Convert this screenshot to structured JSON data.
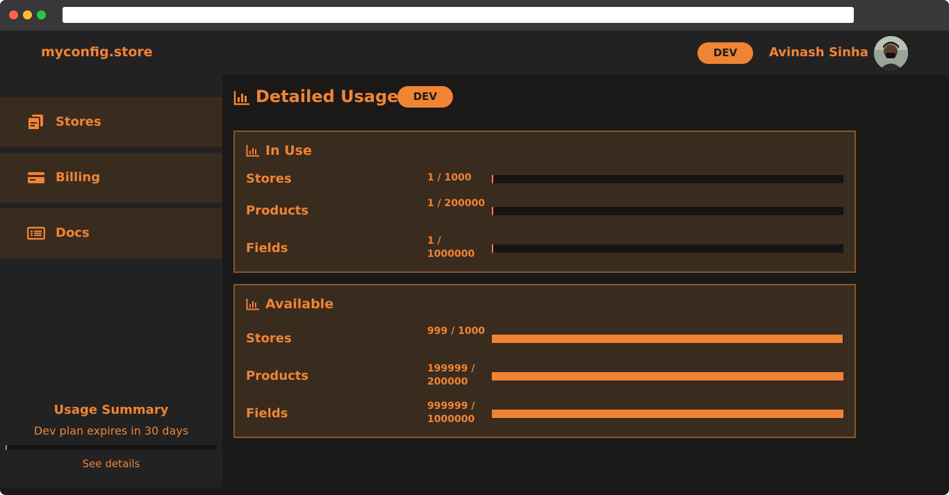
{
  "browser": {
    "url": ""
  },
  "header": {
    "brand": "myconfig.store",
    "env_badge": "DEV",
    "username": "Avinash Sinha",
    "avatar_icon": "user-avatar"
  },
  "sidebar": {
    "items": [
      {
        "label": "Stores",
        "icon": "stores-icon"
      },
      {
        "label": "Billing",
        "icon": "credit-card-icon"
      },
      {
        "label": "Docs",
        "icon": "docs-icon"
      }
    ],
    "usage_summary": {
      "title": "Usage Summary",
      "subtitle": "Dev plan expires in 30 days",
      "progress": 0.003,
      "link": "See details"
    }
  },
  "main": {
    "title": "Detailed Usage",
    "env_badge": "DEV",
    "in_use": {
      "title": "In Use",
      "rows": [
        {
          "label": "Stores",
          "value": "1 / 1000",
          "fraction": 0.001
        },
        {
          "label": "Products",
          "value": "1 / 200000",
          "fraction": 5e-06
        },
        {
          "label": "Fields",
          "value": "1 / 1000000",
          "fraction": 1e-06
        }
      ]
    },
    "available": {
      "title": "Available",
      "rows": [
        {
          "label": "Stores",
          "value": "999 / 1000",
          "fraction": 0.999
        },
        {
          "label": "Products",
          "value": "199999 / 200000",
          "fraction": 0.999995
        },
        {
          "label": "Fields",
          "value": "999999 / 1000000",
          "fraction": 0.999999
        }
      ]
    }
  },
  "colors": {
    "accent": "#f08434",
    "card_bg": "#3a2b1f",
    "card_border": "#8a5527"
  }
}
